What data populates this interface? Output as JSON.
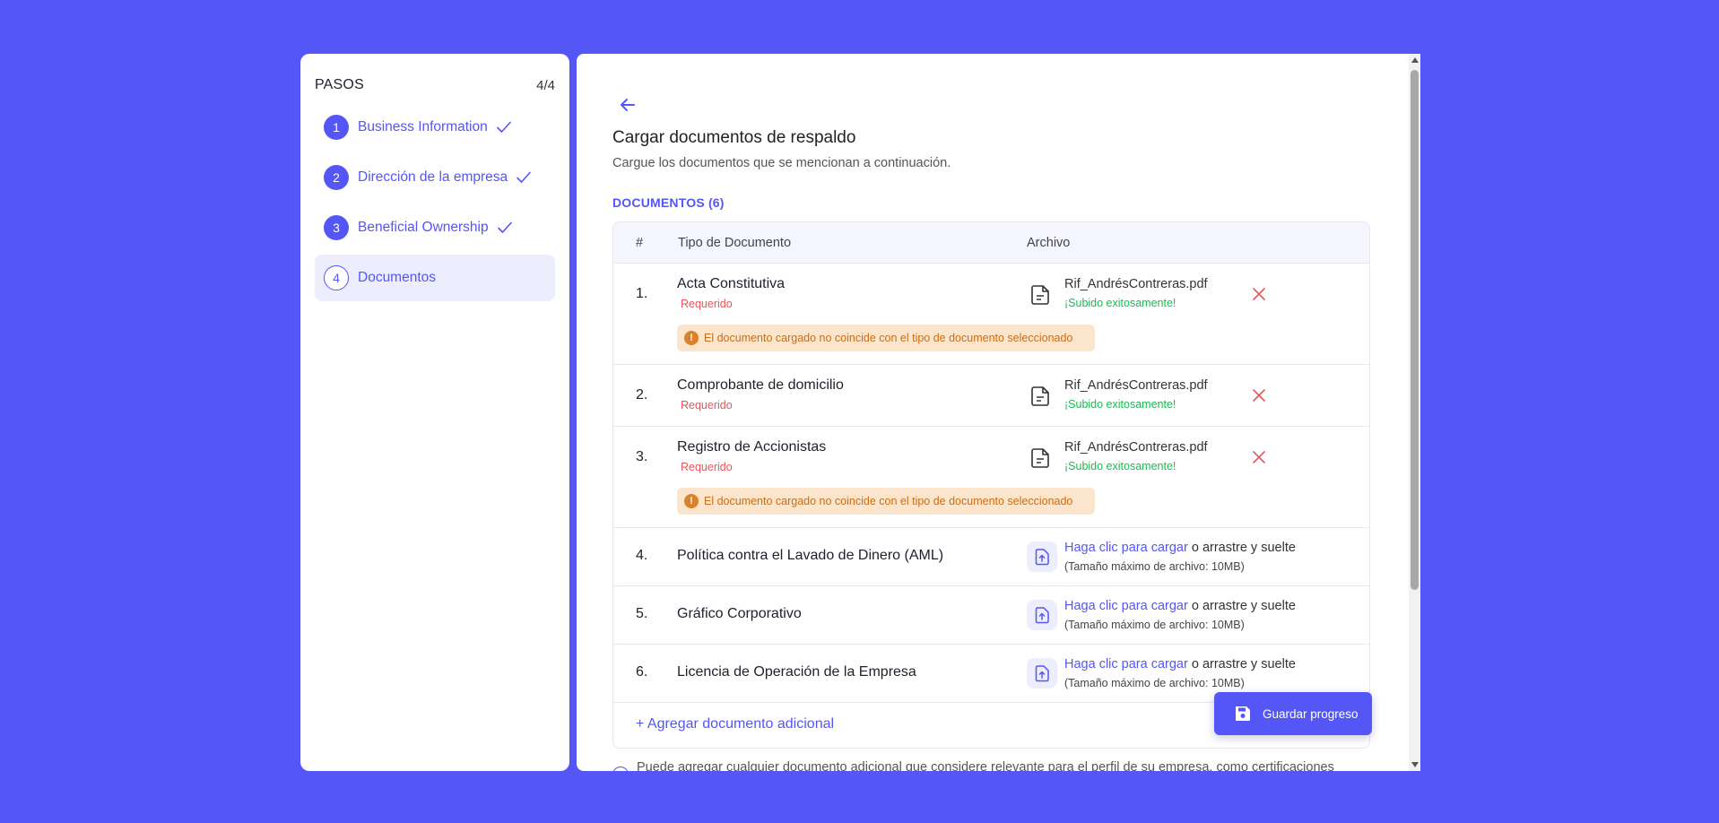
{
  "steps": {
    "title": "PASOS",
    "count": "4/4",
    "items": [
      {
        "num": "1",
        "label": "Business Information",
        "done": true
      },
      {
        "num": "2",
        "label": "Dirección de la empresa",
        "done": true
      },
      {
        "num": "3",
        "label": "Beneficial Ownership",
        "done": true
      },
      {
        "num": "4",
        "label": "Documentos",
        "done": false,
        "active": true
      }
    ]
  },
  "main": {
    "title": "Cargar documentos de respaldo",
    "subtitle": "Cargue los documentos que se mencionan a continuación.",
    "section_label": "DOCUMENTOS (6)",
    "table_headers": {
      "num": "#",
      "type": "Tipo de Documento",
      "file": "Archivo"
    },
    "rows": [
      {
        "num": "1.",
        "name": "Acta Constitutiva",
        "required": "Requerido",
        "file": "Rif_AndrésContreras.pdf",
        "status": "¡Subido exitosamente!",
        "warning": "El documento cargado no coincide con el tipo de documento seleccionado"
      },
      {
        "num": "2.",
        "name": "Comprobante de domicilio",
        "required": "Requerido",
        "file": "Rif_AndrésContreras.pdf",
        "status": "¡Subido exitosamente!"
      },
      {
        "num": "3.",
        "name": "Registro de Accionistas",
        "required": "Requerido",
        "file": "Rif_AndrésContreras.pdf",
        "status": "¡Subido exitosamente!",
        "warning": "El documento cargado no coincide con el tipo de documento seleccionado"
      },
      {
        "num": "4.",
        "name": "Política contra el Lavado de Dinero (AML)",
        "upload_link": "Haga clic para cargar",
        "upload_rest": " o arrastre y suelte",
        "upload_hint": "(Tamaño máximo de archivo: 10MB)"
      },
      {
        "num": "5.",
        "name": "Gráfico Corporativo",
        "upload_link": "Haga clic para cargar",
        "upload_rest": " o arrastre y suelte",
        "upload_hint": "(Tamaño máximo de archivo: 10MB)"
      },
      {
        "num": "6.",
        "name": "Licencia de Operación de la Empresa",
        "upload_link": "Haga clic para cargar",
        "upload_rest": " o arrastre y suelte",
        "upload_hint": "(Tamaño máximo de archivo: 10MB)"
      }
    ],
    "add_document": "+ Agregar documento adicional",
    "save_label": "Guardar progreso",
    "footer_note": "Puede agregar cualquier documento adicional que considere relevante para el perfil de su empresa, como certificaciones"
  },
  "colors": {
    "accent": "#5456F5",
    "danger": "#E5565A",
    "success": "#1DB954",
    "warning_bg": "#FBE5CC",
    "warning_text": "#C96E16"
  }
}
